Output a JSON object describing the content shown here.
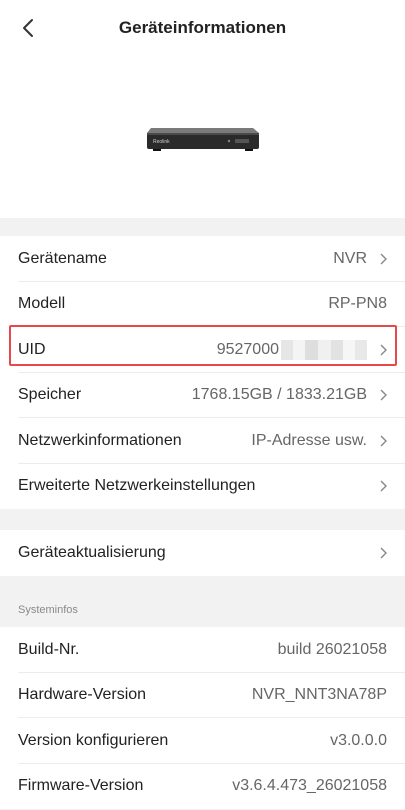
{
  "header": {
    "title": "Geräteinformationen"
  },
  "device_info": [
    {
      "key": "name",
      "label": "Gerätename",
      "value": "NVR",
      "chevron": true
    },
    {
      "key": "model",
      "label": "Modell",
      "value": "RP-PN8",
      "chevron": false
    },
    {
      "key": "uid",
      "label": "UID",
      "value": "9527000",
      "chevron": true
    },
    {
      "key": "storage",
      "label": "Speicher",
      "value": "1768.15GB / 1833.21GB",
      "chevron": true
    },
    {
      "key": "network",
      "label": "Netzwerkinformationen",
      "value": "IP-Adresse usw.",
      "chevron": true
    },
    {
      "key": "advanced",
      "label": "Erweiterte Netzwerkeinstellungen",
      "value": "",
      "chevron": true
    }
  ],
  "update": {
    "label": "Geräteaktualisierung"
  },
  "system": {
    "caption": "Systeminfos",
    "rows": [
      {
        "label": "Build-Nr.",
        "value": "build 26021058"
      },
      {
        "label": "Hardware-Version",
        "value": "NVR_NNT3NA78P"
      },
      {
        "label": "Version konfigurieren",
        "value": "v3.0.0.0"
      },
      {
        "label": "Firmware-Version",
        "value": "v3.6.4.473_26021058"
      }
    ]
  },
  "device_image": {
    "brand_text": "Reolink"
  },
  "colors": {
    "highlight": "#e8484a",
    "background": "#f2f2f2",
    "card": "#ffffff"
  },
  "icons": [
    "back-arrow-icon",
    "chevron-right-icon"
  ]
}
